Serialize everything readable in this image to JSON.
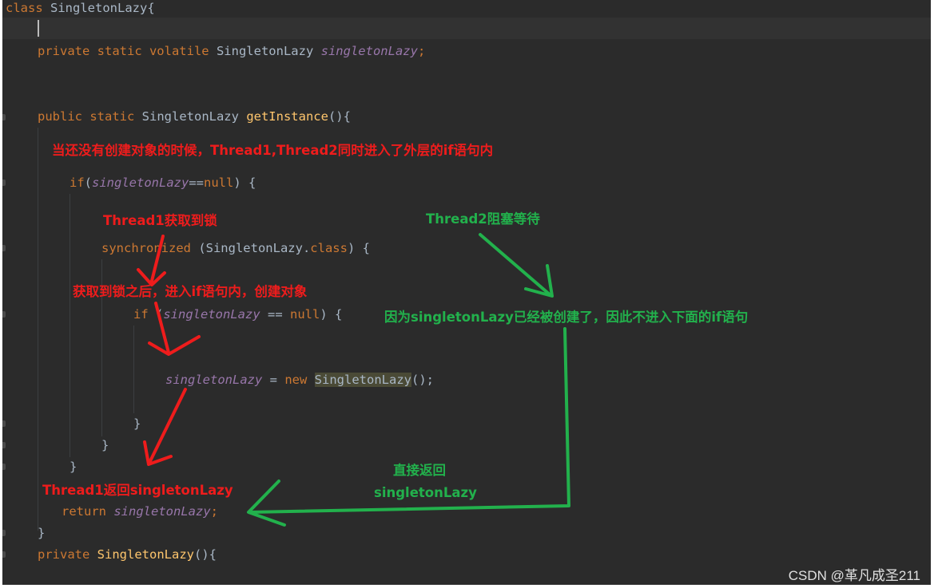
{
  "code": {
    "line1": {
      "kw": "class",
      "rest": " SingletonLazy{"
    },
    "line3": {
      "kw": "private static volatile",
      "type": " SingletonLazy ",
      "field": "singletonLazy",
      "end": ";"
    },
    "line6": {
      "kw": "public static",
      "type": " SingletonLazy ",
      "method": "getInstance",
      "end": "(){"
    },
    "line8": {
      "kw": "if",
      "open": "(",
      "field": "singletonLazy",
      "mid": "==",
      "kw2": "null",
      "end": ") {"
    },
    "line10": {
      "kw": "synchronized",
      "mid": " (SingletonLazy.",
      "kw2": "class",
      "end": ") {"
    },
    "line12": {
      "kw": "if",
      "open": " (",
      "field": "singletonLazy",
      "mid": " == ",
      "kw2": "null",
      "end": ") {"
    },
    "line14": {
      "field": "singletonLazy",
      "mid": " = ",
      "kw": "new",
      "sp": " ",
      "cls": "SingletonLazy",
      "end": "();"
    },
    "line15": "}",
    "line16": "}",
    "line17": "}",
    "line19": {
      "kw": "return",
      "sp": " ",
      "field": "singletonLazy",
      "end": ";"
    },
    "line20": "}",
    "line21": {
      "kw": "private",
      "sp": " ",
      "method": "SingletonLazy",
      "end": "(){"
    }
  },
  "annotations": {
    "both_threads_enter": "当还没有创建对象的时候，Thread1,Thread2同时进入了外层的if语句内",
    "thread1_lock": "Thread1获取到锁",
    "thread2_wait": "Thread2阻塞等待",
    "after_lock": "获取到锁之后，进入if语句内，创建对象",
    "already_created": "因为singletonLazy已经被创建了，因此不进入下面的if语句",
    "return_directly_1": "直接返回",
    "return_directly_2": "singletonLazy",
    "thread1_return": "Thread1返回singletonLazy"
  },
  "colors": {
    "editor_bg": "#2b2b2b",
    "keyword": "#cc7832",
    "field": "#9876aa",
    "method": "#ffc66d",
    "text": "#a9b7c6",
    "annotation_red": "#ee1c1c",
    "annotation_green": "#22b14c"
  },
  "watermark": "CSDN @革凡成圣211"
}
